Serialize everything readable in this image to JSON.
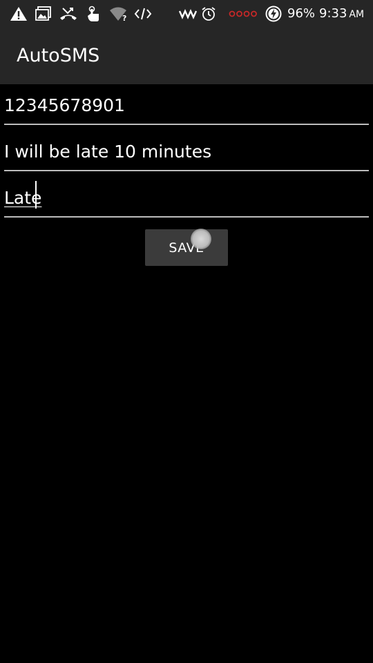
{
  "status_bar": {
    "battery_percent": "96%",
    "time": "9:33",
    "ampm": "AM",
    "notification_icons": [
      "warning-icon",
      "gallery-icon",
      "missed-call-icon",
      "touch-icon",
      "wifi-question-icon",
      "code-icon"
    ],
    "system_icons": [
      "signal-wave-icon",
      "alarm-icon",
      "no-signal-icon",
      "battery-charging-icon"
    ],
    "accent_red": "#c62828"
  },
  "app_bar": {
    "title": "AutoSMS"
  },
  "form": {
    "phone_value": "12345678901",
    "message_value": "I will be late 10 minutes",
    "name_value": "Late",
    "save_label": "SAVE"
  },
  "colors": {
    "background": "#000000",
    "bar": "#262626",
    "button": "#3b3b3b",
    "underline": "#bdbdbd"
  }
}
